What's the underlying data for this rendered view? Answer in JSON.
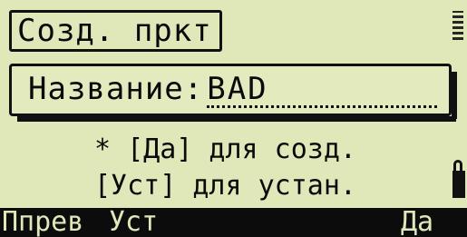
{
  "screen": {
    "title": "Созд. пркт"
  },
  "form": {
    "name_label": "Название:",
    "name_value": "BAD"
  },
  "messages": {
    "line1": "* [Да] для созд.",
    "line2": "[Уст] для устан."
  },
  "softkeys": {
    "key1": "Ппрев",
    "key2": "Уст",
    "key3": "",
    "key4": "Да"
  },
  "colors": {
    "lcd_background": "#e0e7b8",
    "foreground": "#0a0a0a",
    "softkey_bar": "#0c0c0c"
  },
  "icons": {
    "top_right": "scroll-indicator-icon",
    "right": "lock-icon"
  }
}
